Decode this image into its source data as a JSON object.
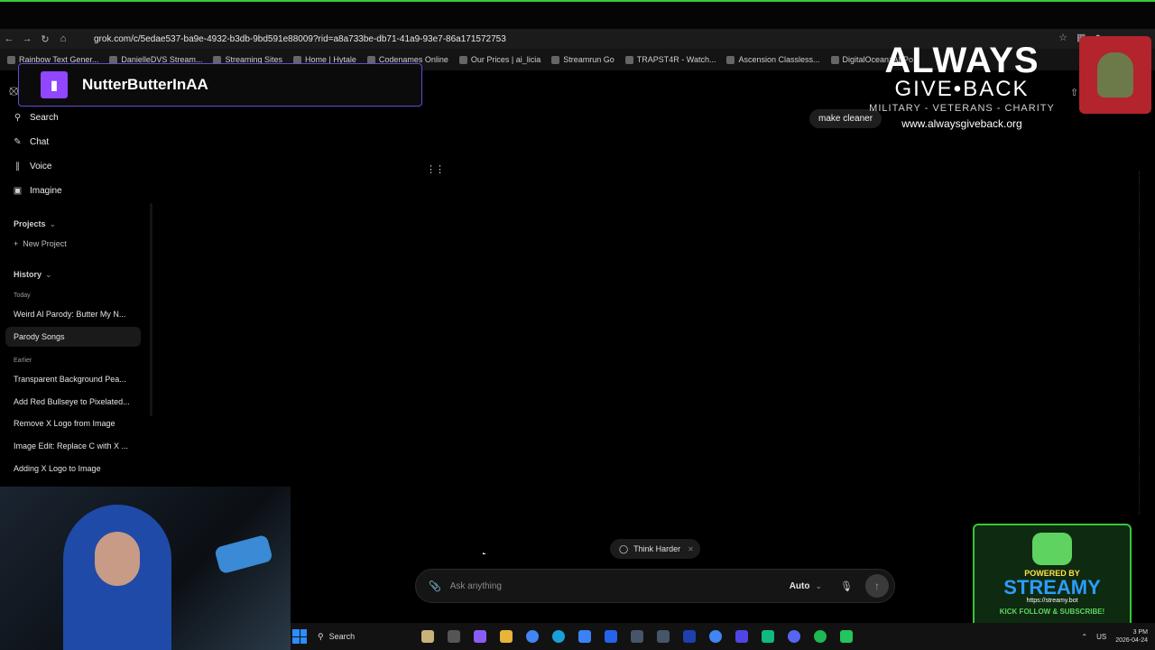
{
  "browser": {
    "url": "grok.com/c/5edae537-ba9e-4932-b3db-9bd591e88009?rid=a8a733be-db71-41a9-93e7-86a171572753",
    "bookmarks": [
      "Rainbow Text Gener...",
      "DanielleDVS Stream...",
      "Streaming Sites",
      "Home | Hytale",
      "Codenames Online",
      "Our Prices | ai_licia",
      "Streamrun Go",
      "TRAPST4R - Watch...",
      "Ascension Classless...",
      "DigitalOcean: AI-Po..."
    ]
  },
  "overlay": {
    "twitch_name": "NutterButterInAA",
    "agb_line1": "ALWAYS",
    "agb_line2": "GIVE•BACK",
    "agb_line3": "MILITARY - VETERANS - CHARITY",
    "agb_site": "www.alwaysgiveback.org",
    "streamy_powered": "POWERED BY",
    "streamy_name": "STREAMY",
    "streamy_url": "https://streamy.bot",
    "streamy_kick": "KICK  FOLLOW & SUBSCRIBE!"
  },
  "sidebar": {
    "nav": [
      {
        "label": "Search",
        "icon": "search-icon"
      },
      {
        "label": "Chat",
        "icon": "chat-icon"
      },
      {
        "label": "Voice",
        "icon": "voice-icon"
      },
      {
        "label": "Imagine",
        "icon": "image-icon"
      }
    ],
    "projects_label": "Projects",
    "new_project_label": "New Project",
    "history_label": "History",
    "today_label": "Today",
    "today_items": [
      "Weird Al Parody: Butter My N...",
      "Parody Songs"
    ],
    "earlier_label": "Earlier",
    "earlier_items": [
      "Transparent Background Pea...",
      "Add Red Bullseye to Pixelated...",
      "Remove X Logo from Image",
      "Image Edit: Replace C with X ...",
      "Adding X Logo to Image"
    ]
  },
  "main": {
    "suggestion_chip": "make cleaner",
    "think_harder_label": "Think Harder",
    "composer_placeholder": "Ask anything",
    "mode_label": "Auto"
  },
  "taskbar": {
    "search_label": "Search",
    "lang": "US",
    "time": "3 PM",
    "date": "2026-04-24"
  }
}
